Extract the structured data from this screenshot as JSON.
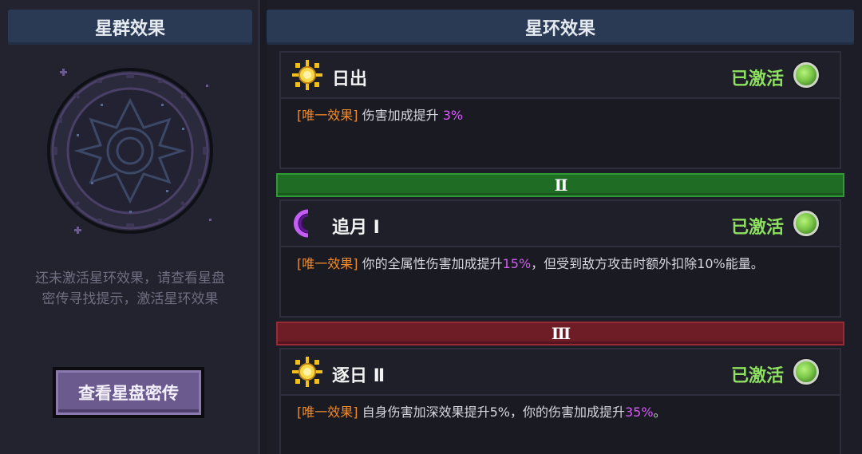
{
  "left_panel": {
    "title": "星群效果",
    "hint_line1": "还未激活星环效果，请查看星盘",
    "hint_line2": "密传寻找提示，激活星环效果",
    "view_button": "查看星盘密传"
  },
  "right_panel": {
    "title": "星环效果",
    "effects": [
      {
        "icon": "sun-icon",
        "name": "日出",
        "status": "已激活",
        "tag": "[唯一效果]",
        "text_before": " 伤害加成提升 ",
        "highlight": "3%",
        "text_after": ""
      },
      {
        "icon": "crescent-moon-icon",
        "name": "追月 Ⅰ",
        "status": "已激活",
        "tag": "[唯一效果]",
        "text_before": " 你的全属性伤害加成提升",
        "highlight": "15%",
        "text_after": "，但受到敌方攻击时额外扣除10%能量。"
      },
      {
        "icon": "sun-icon",
        "name": "逐日 Ⅱ",
        "status": "已激活",
        "tag": "[唯一效果]",
        "text_before": " 自身伤害加深效果提升5%，你的伤害加成提升",
        "highlight": "35%",
        "text_after": "。"
      }
    ],
    "tiers": [
      {
        "label": "Ⅱ",
        "color": "#1f6d24"
      },
      {
        "label": "Ⅲ",
        "color": "#6e1c26"
      }
    ]
  },
  "colors": {
    "active_green": "#8ee060",
    "tag_orange": "#f08a2c",
    "highlight_purple": "#d55cf5",
    "header_blue": "#2a3a54"
  }
}
